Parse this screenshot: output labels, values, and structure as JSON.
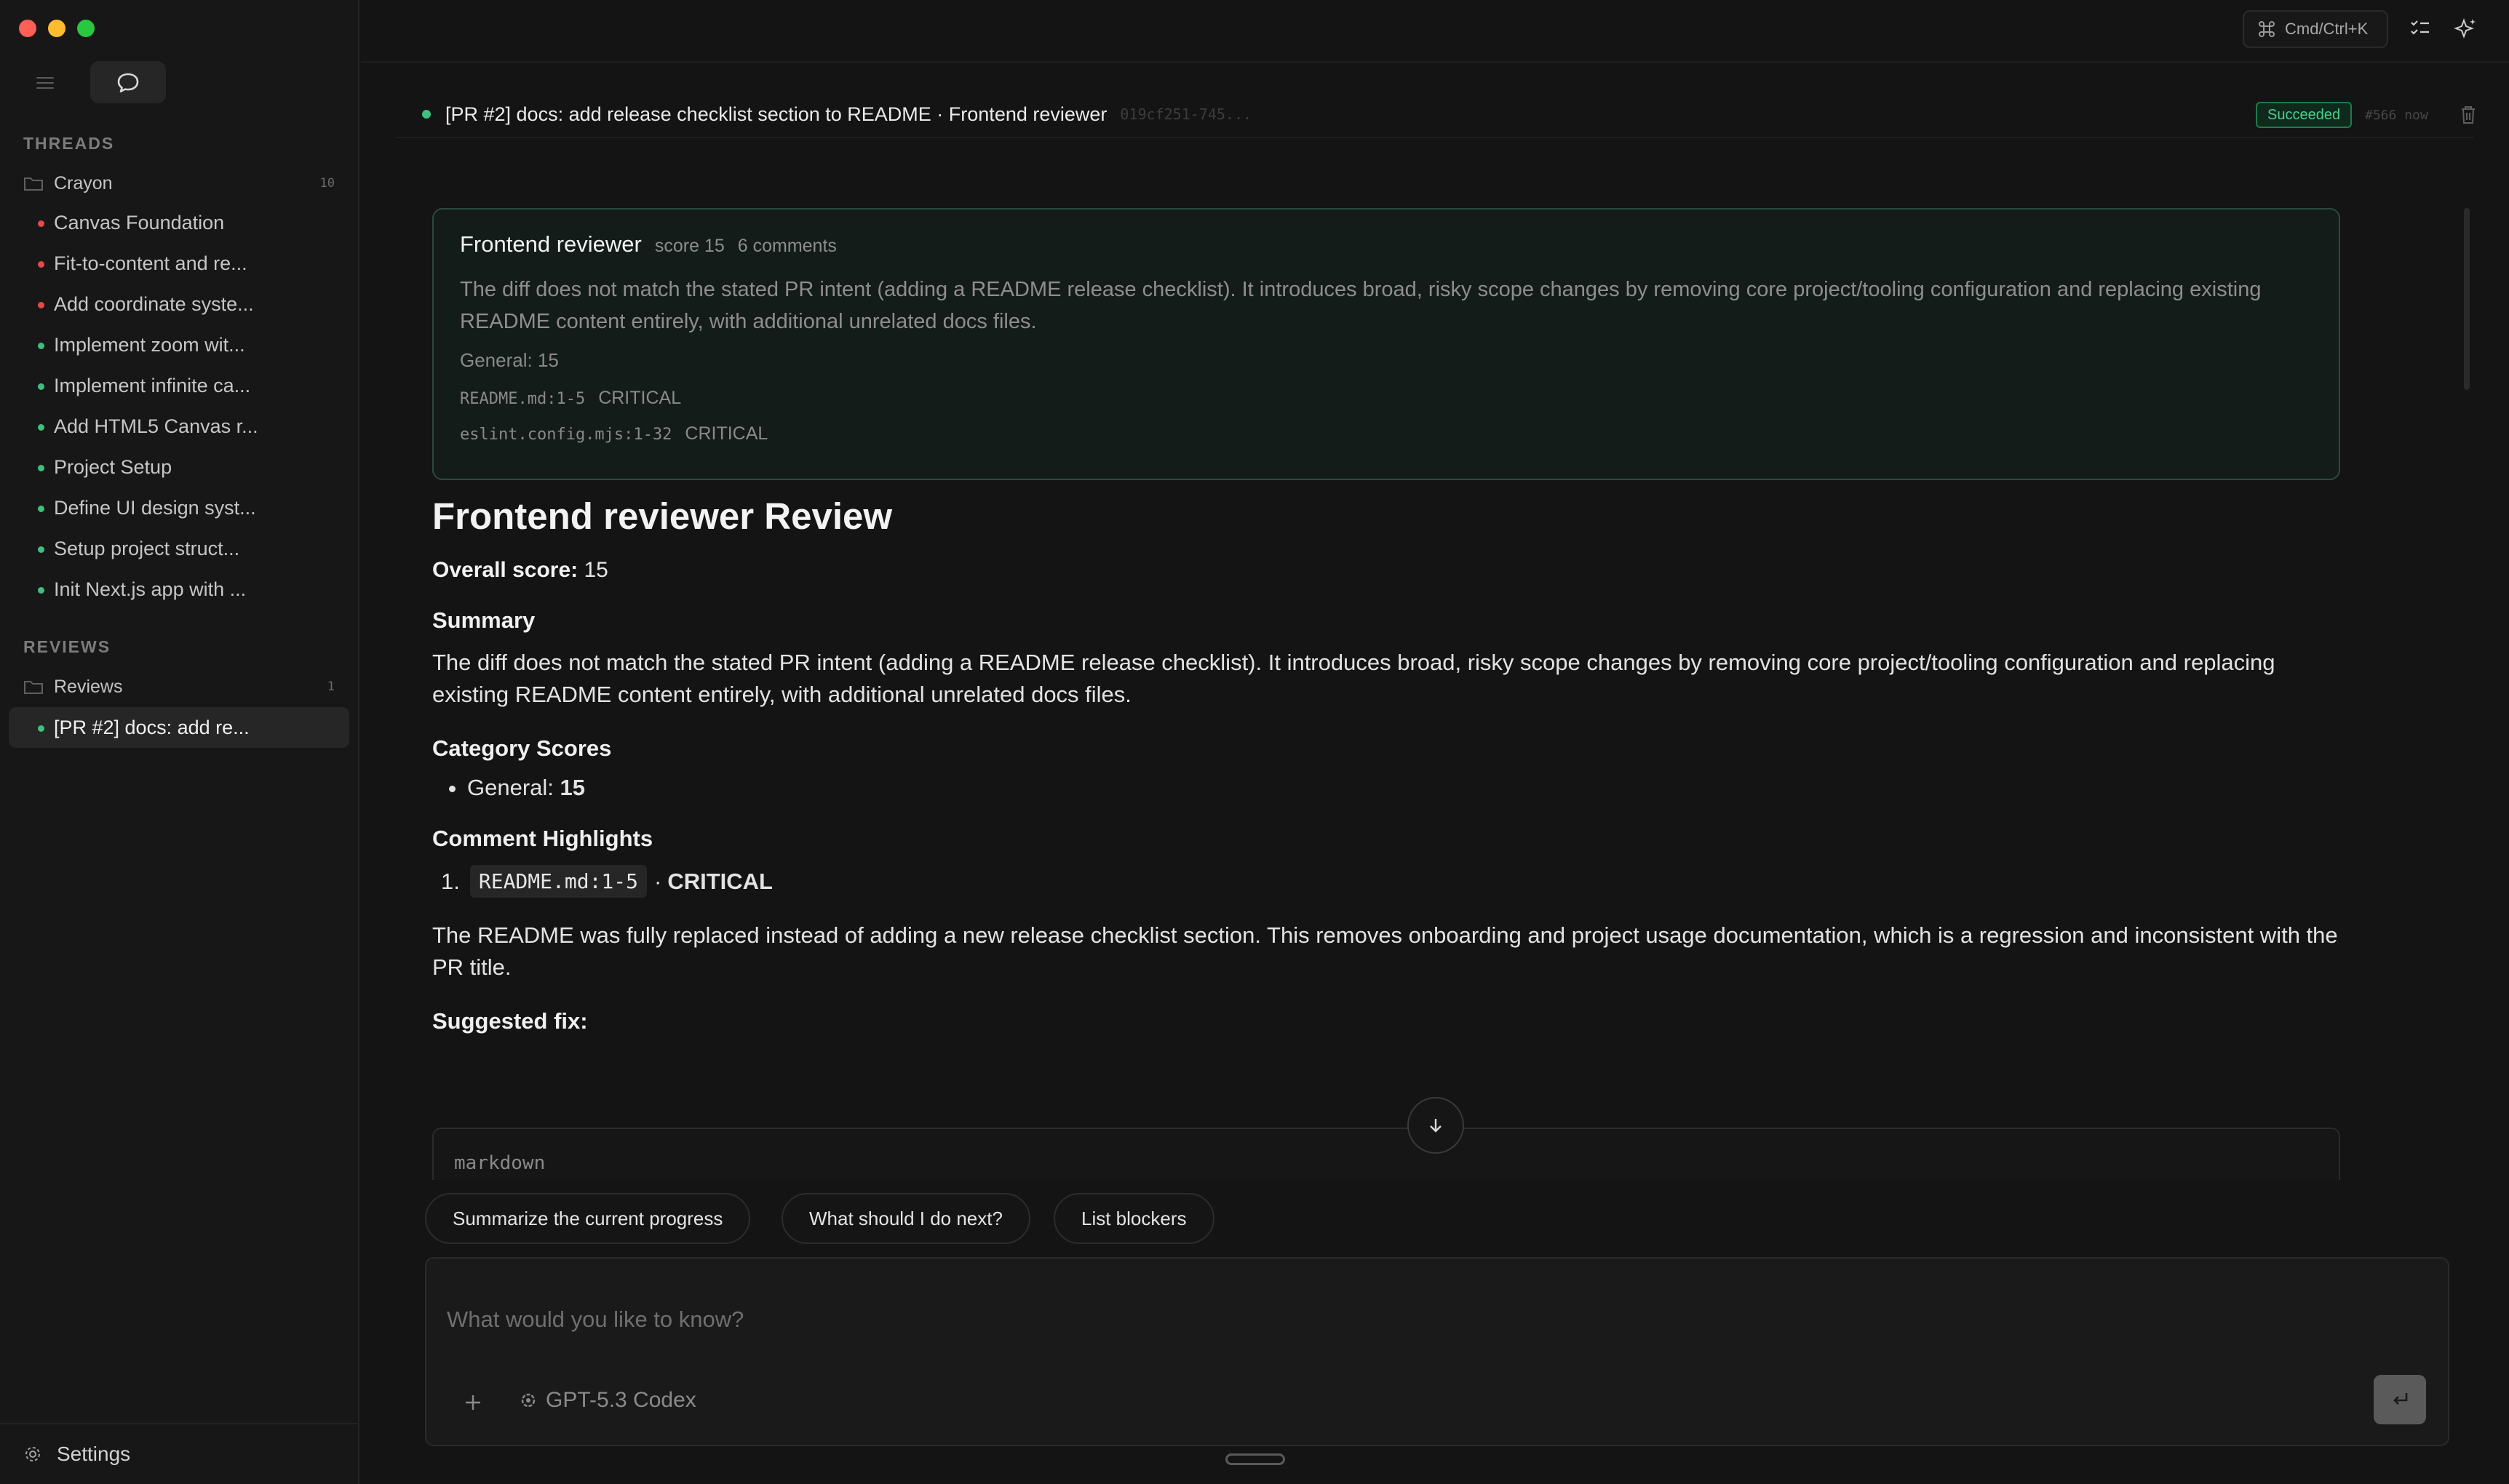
{
  "sidebar": {
    "threads_label": "THREADS",
    "threads_folder": {
      "name": "Crayon",
      "count": "10"
    },
    "threads": [
      {
        "label": "Canvas Foundation",
        "status_color": "#e5484d"
      },
      {
        "label": "Fit-to-content and re...",
        "status_color": "#e5484d"
      },
      {
        "label": "Add coordinate syste...",
        "status_color": "#e5484d"
      },
      {
        "label": "Implement zoom wit...",
        "status_color": "#3fbf7f"
      },
      {
        "label": "Implement infinite ca...",
        "status_color": "#3fbf7f"
      },
      {
        "label": "Add HTML5 Canvas r...",
        "status_color": "#3fbf7f"
      },
      {
        "label": "Project Setup",
        "status_color": "#3fbf7f"
      },
      {
        "label": "Define UI design syst...",
        "status_color": "#3fbf7f"
      },
      {
        "label": "Setup project struct...",
        "status_color": "#3fbf7f"
      },
      {
        "label": "Init Next.js app with ...",
        "status_color": "#3fbf7f"
      }
    ],
    "reviews_label": "REVIEWS",
    "reviews_folder": {
      "name": "Reviews",
      "count": "1"
    },
    "reviews": [
      {
        "label": "[PR #2] docs: add re...",
        "status_color": "#3fbf7f",
        "active": true
      }
    ],
    "settings_label": "Settings"
  },
  "topbar": {
    "shortcut_label": "Cmd/Ctrl+K",
    "icons": [
      "command-icon",
      "checklist-icon",
      "sparkle-icon"
    ]
  },
  "run": {
    "title": "[PR #2] docs: add release checklist section to README · Frontend reviewer",
    "hash": "019cf251-745...",
    "status": "Succeeded",
    "run_number": "#566",
    "time": "now",
    "accent": "#3fbf7f"
  },
  "card": {
    "reviewer": "Frontend reviewer",
    "score": "score 15",
    "comments": "6 comments",
    "summary": "The diff does not match the stated PR intent (adding a README release checklist). It introduces broad, risky scope changes by removing core project/tooling configuration and replacing existing README content entirely, with additional unrelated docs files.",
    "general": "General: 15",
    "issues": [
      {
        "location": "README.md:1-5",
        "severity": "CRITICAL"
      },
      {
        "location": "eslint.config.mjs:1-32",
        "severity": "CRITICAL"
      }
    ]
  },
  "review": {
    "heading": "Frontend reviewer Review",
    "overall_label": "Overall score:",
    "overall_value": "15",
    "summary_heading": "Summary",
    "summary_text": "The diff does not match the stated PR intent (adding a README release checklist). It introduces broad, risky scope changes by removing core project/tooling configuration and replacing existing README content entirely, with additional unrelated docs files.",
    "category_heading": "Category Scores",
    "category_item_label": "General:",
    "category_item_value": "15",
    "highlights_heading": "Comment Highlights",
    "highlight_number": "1.",
    "highlight_code": "README.md:1-5",
    "highlight_sep": "·",
    "highlight_severity": "CRITICAL",
    "highlight_text": "The README was fully replaced instead of adding a new release checklist section. This removes onboarding and project usage documentation, which is a regression and inconsistent with the PR title.",
    "fix_heading": "Suggested fix:",
    "code_lang": "markdown"
  },
  "suggestions": [
    "Summarize the current progress",
    "What should I do next?",
    "List blockers"
  ],
  "composer": {
    "placeholder": "What would you like to know?",
    "model": "GPT-5.3 Codex"
  }
}
